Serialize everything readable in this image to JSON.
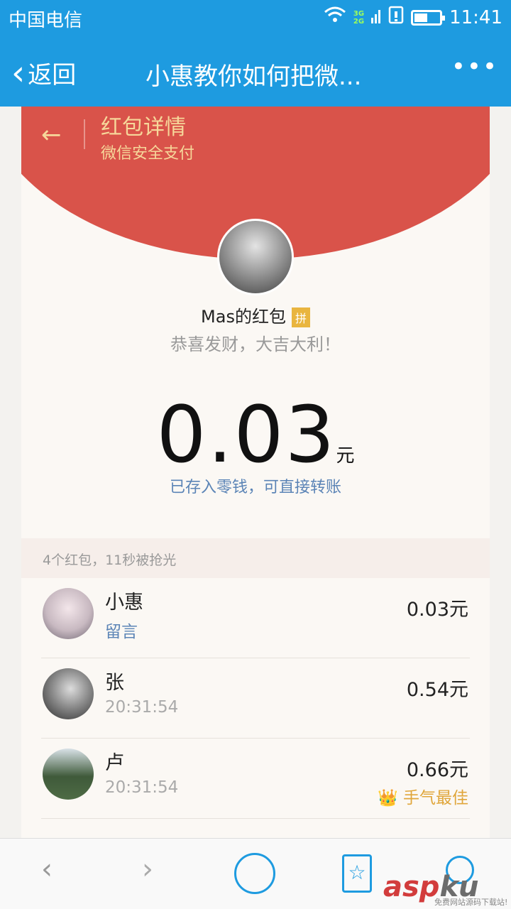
{
  "status": {
    "carrier": "中国电信",
    "net_top": "3G",
    "net_bottom": "2G",
    "time": "11:41"
  },
  "nav": {
    "back_label": "返回",
    "title": "小惠教你如何把微...",
    "more": "•••"
  },
  "header": {
    "back_arrow": "←",
    "title": "红包详情",
    "subtitle": "微信安全支付"
  },
  "packet": {
    "sender_title": "Mas的红包",
    "tag": "拼",
    "wish": "恭喜发财，大吉大利！",
    "amount": "0.03",
    "unit": "元",
    "note": "已存入零钱，可直接转账",
    "summary": "4个红包，11秒被抢光"
  },
  "receivers": [
    {
      "name": "小惠",
      "sub": "留言",
      "amount": "0.03元",
      "best": ""
    },
    {
      "name": "张",
      "sub": "20:31:54",
      "amount": "0.54元",
      "best": ""
    },
    {
      "name": "卢",
      "sub": "20:31:54",
      "amount": "0.66元",
      "best": "👑 手气最佳"
    }
  ],
  "bottom": {
    "back": "‹",
    "forward": "›",
    "star": "☆"
  },
  "watermark": {
    "brand_a": "asp",
    "brand_b": "ku",
    "caption": "免费网站源码下载站!"
  },
  "colors": {
    "blue": "#1e9be0",
    "red": "#d9534a",
    "gold": "#f6d79a"
  }
}
